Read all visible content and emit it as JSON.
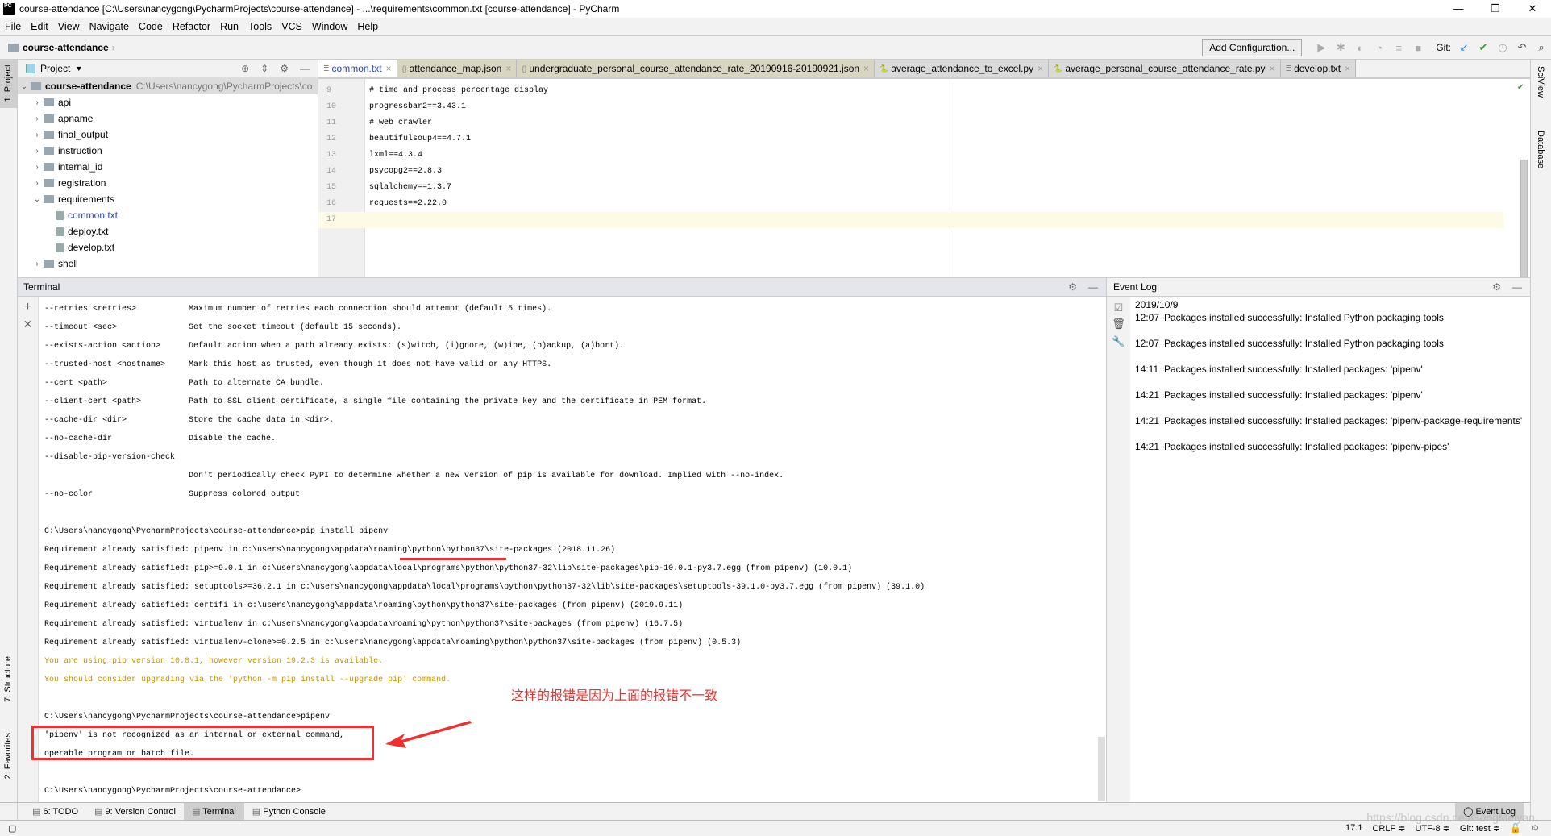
{
  "window": {
    "title": "course-attendance [C:\\Users\\nancygong\\PycharmProjects\\course-attendance] - ...\\requirements\\common.txt [course-attendance] - PyCharm",
    "logo": "PC",
    "minimize": "—",
    "restore": "❐",
    "close": "✕"
  },
  "menu": [
    "File",
    "Edit",
    "View",
    "Navigate",
    "Code",
    "Refactor",
    "Run",
    "Tools",
    "VCS",
    "Window",
    "Help"
  ],
  "navbar": {
    "crumb": "course-attendance",
    "toolbar": {
      "add_config": "Add Configuration...",
      "git_label": "Git:"
    }
  },
  "left_stripe": {
    "project": "1: Project",
    "structure": "7: Structure",
    "favorites": "2: Favorites"
  },
  "right_stripe": {
    "sciview": "SciView",
    "database": "Database"
  },
  "project": {
    "header": "Project",
    "root": {
      "name": "course-attendance",
      "path": "C:\\Users\\nancygong\\PycharmProjects\\co"
    },
    "items": [
      {
        "name": "api",
        "type": "folder",
        "expanded": false
      },
      {
        "name": "apname",
        "type": "folder",
        "expanded": false
      },
      {
        "name": "final_output",
        "type": "folder",
        "expanded": false
      },
      {
        "name": "instruction",
        "type": "folder",
        "expanded": false
      },
      {
        "name": "internal_id",
        "type": "folder",
        "expanded": false
      },
      {
        "name": "registration",
        "type": "folder",
        "expanded": false
      },
      {
        "name": "requirements",
        "type": "folder",
        "expanded": true
      },
      {
        "name": "common.txt",
        "type": "file",
        "selected": true
      },
      {
        "name": "deploy.txt",
        "type": "file"
      },
      {
        "name": "develop.txt",
        "type": "file"
      },
      {
        "name": "shell",
        "type": "folder",
        "expanded": false
      }
    ]
  },
  "tabs": [
    {
      "label": "common.txt",
      "kind": "active"
    },
    {
      "label": "attendance_map.json",
      "kind": "json"
    },
    {
      "label": "undergraduate_personal_course_attendance_rate_20190916-20190921.json",
      "kind": "json"
    },
    {
      "label": "average_attendance_to_excel.py",
      "kind": "py"
    },
    {
      "label": "average_personal_course_attendance_rate.py",
      "kind": "py"
    },
    {
      "label": "develop.txt",
      "kind": "txt"
    }
  ],
  "editor": {
    "lines": [
      {
        "n": "9",
        "text": "# time and process percentage display"
      },
      {
        "n": "10",
        "text": "progressbar2==3.43.1"
      },
      {
        "n": "11",
        "text": "# web crawler"
      },
      {
        "n": "12",
        "text": "beautifulsoup4==4.7.1"
      },
      {
        "n": "13",
        "text": "lxml==4.3.4"
      },
      {
        "n": "14",
        "text": "psycopg2==2.8.3"
      },
      {
        "n": "15",
        "text": "sqlalchemy==1.3.7"
      },
      {
        "n": "16",
        "text": "requests==2.22.0"
      },
      {
        "n": "17",
        "text": ""
      }
    ],
    "current_line": "17"
  },
  "terminal": {
    "title": "Terminal",
    "lines": [
      {
        "opt": "--retries <retries>",
        "desc": "Maximum number of retries each connection should attempt (default 5 times)."
      },
      {
        "opt": "--timeout <sec>",
        "desc": "Set the socket timeout (default 15 seconds)."
      },
      {
        "opt": "--exists-action <action>",
        "desc": "Default action when a path already exists: (s)witch, (i)gnore, (w)ipe, (b)ackup, (a)bort)."
      },
      {
        "opt": "--trusted-host <hostname>",
        "desc": "Mark this host as trusted, even though it does not have valid or any HTTPS."
      },
      {
        "opt": "--cert <path>",
        "desc": "Path to alternate CA bundle."
      },
      {
        "opt": "--client-cert <path>",
        "desc": "Path to SSL client certificate, a single file containing the private key and the certificate in PEM format."
      },
      {
        "opt": "--cache-dir <dir>",
        "desc": "Store the cache data in <dir>."
      },
      {
        "opt": "--no-cache-dir",
        "desc": "Disable the cache."
      },
      {
        "opt": "--disable-pip-version-check",
        "desc": ""
      },
      {
        "opt": "",
        "desc": "Don't periodically check PyPI to determine whether a new version of pip is available for download. Implied with --no-index."
      },
      {
        "opt": "--no-color",
        "desc": "Suppress colored output"
      },
      {
        "text": ""
      },
      {
        "text": "C:\\Users\\nancygong\\PycharmProjects\\course-attendance>pip install pipenv"
      },
      {
        "text": "Requirement already satisfied: pipenv in c:\\users\\nancygong\\appdata\\roaming\\python\\python37\\site-packages (2018.11.26)"
      },
      {
        "text": "Requirement already satisfied: pip>=9.0.1 in c:\\users\\nancygong\\appdata\\local\\programs\\python\\python37-32\\lib\\site-packages\\pip-10.0.1-py3.7.egg (from pipenv) (10.0.1)"
      },
      {
        "text": "Requirement already satisfied: setuptools>=36.2.1 in c:\\users\\nancygong\\appdata\\local\\programs\\python\\python37-32\\lib\\site-packages\\setuptools-39.1.0-py3.7.egg (from pipenv) (39.1.0)"
      },
      {
        "text": "Requirement already satisfied: certifi in c:\\users\\nancygong\\appdata\\roaming\\python\\python37\\site-packages (from pipenv) (2019.9.11)"
      },
      {
        "text": "Requirement already satisfied: virtualenv in c:\\users\\nancygong\\appdata\\roaming\\python\\python37\\site-packages (from pipenv) (16.7.5)"
      },
      {
        "text": "Requirement already satisfied: virtualenv-clone>=0.2.5 in c:\\users\\nancygong\\appdata\\roaming\\python\\python37\\site-packages (from pipenv) (0.5.3)"
      },
      {
        "text": "You are using pip version 10.0.1, however version 19.2.3 is available.",
        "warn": true
      },
      {
        "text": "You should consider upgrading via the 'python -m pip install --upgrade pip' command.",
        "warn": true
      },
      {
        "text": ""
      },
      {
        "text": "C:\\Users\\nancygong\\PycharmProjects\\course-attendance>pipenv"
      },
      {
        "text": "'pipenv' is not recognized as an internal or external command,"
      },
      {
        "text": "operable program or batch file."
      },
      {
        "text": ""
      },
      {
        "text": "C:\\Users\\nancygong\\PycharmProjects\\course-attendance>"
      }
    ]
  },
  "annotation": {
    "text": "这样的报错是因为上面的报错不一致",
    "color": "#f03030"
  },
  "event_log": {
    "title": "Event Log",
    "date": "2019/10/9",
    "entries": [
      {
        "time": "12:07",
        "msg": "Packages installed successfully: Installed Python packaging tools"
      },
      {
        "time": "12:07",
        "msg": "Packages installed successfully: Installed Python packaging tools"
      },
      {
        "time": "14:11",
        "msg": "Packages installed successfully: Installed packages: 'pipenv'"
      },
      {
        "time": "14:21",
        "msg": "Packages installed successfully: Installed packages: 'pipenv'"
      },
      {
        "time": "14:21",
        "msg": "Packages installed successfully: Installed packages: 'pipenv-package-requirements'"
      },
      {
        "time": "14:21",
        "msg": "Packages installed successfully: Installed packages: 'pipenv-pipes'"
      }
    ]
  },
  "bottom_tabs": [
    {
      "label": "6: TODO"
    },
    {
      "label": "9: Version Control"
    },
    {
      "label": "Terminal",
      "active": true
    },
    {
      "label": "Python Console"
    }
  ],
  "event_log_button": "Event Log",
  "status": {
    "position": "17:1",
    "line_sep": "CRLF ≑",
    "encoding": "UTF-8 ≑",
    "git": "Git: test ≑"
  },
  "watermark": "https://blog.csdn.net/GongMeiyan"
}
